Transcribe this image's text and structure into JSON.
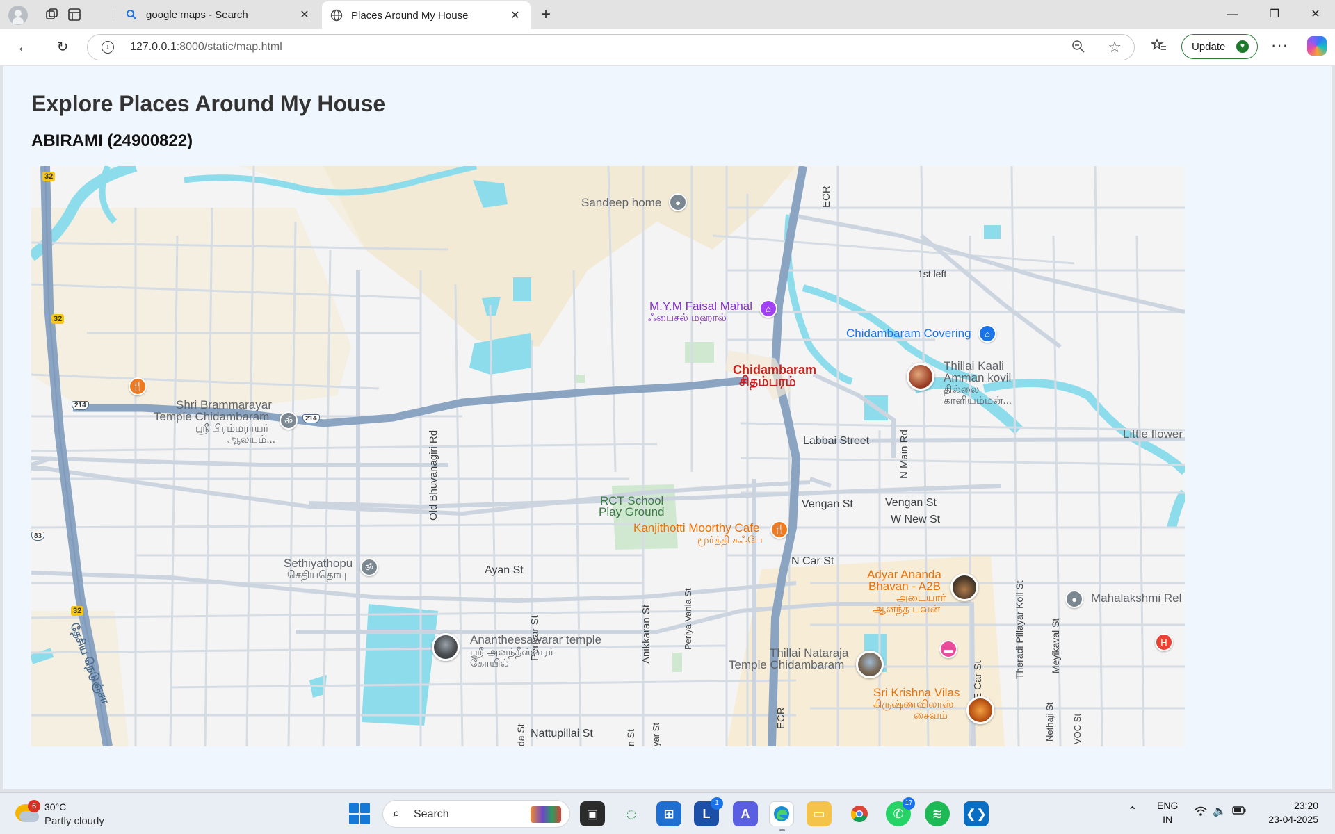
{
  "browser": {
    "tabs": [
      {
        "title": "google maps - Search",
        "icon": "search-icon",
        "active": false
      },
      {
        "title": "Places Around My House",
        "icon": "globe-icon",
        "active": true
      }
    ],
    "url_host": "127.0.0.1",
    "url_rest": ":8000/static/map.html",
    "update_label": "Update"
  },
  "page": {
    "title": "Explore Places Around My House",
    "subtitle": "ABIRAMI (24900822)"
  },
  "map": {
    "places": {
      "sandeep_home": "Sandeep home",
      "faisal_mahal": "M.Y.M Faisal Mahal",
      "faisal_mahal_ta": "ஃபைசல் மஹால்",
      "chidambaram_covering": "Chidambaram Covering",
      "chidambaram": "Chidambaram",
      "chidambaram_ta": "சிதம்பரம்",
      "thillai_kaali_1": "Thillai Kaali",
      "thillai_kaali_2": "Amman kovil",
      "thillai_kaali_ta1": "தில்லை",
      "thillai_kaali_ta2": "காளியம்மன்...",
      "brammarayar_1": "Shri Brammarayar",
      "brammarayar_2": "Temple Chidambaram",
      "brammarayar_ta1": "ஸ்ரீ பிரம்மராயர்",
      "brammarayar_ta2": "ஆலயம்...",
      "little_flower": "Little flower",
      "rct_1": "RCT School",
      "rct_2": "Play Ground",
      "kanjithotti": "Kanjithotti Moorthy Cafe",
      "kanjithotti_ta": "மூர்த்தி கஃபே",
      "sethiyathopu": "Sethiyathopu",
      "sethiyathopu_ta": "செதியதொபு",
      "adyar_1": "Adyar Ananda",
      "adyar_2": "Bhavan - A2B",
      "adyar_ta1": "அடையார்",
      "adyar_ta2": "ஆனந்த பவன்",
      "mahalakshmi": "Mahalakshmi Rel",
      "anantheesawarar": "Anantheesawarar temple",
      "anantheesawarar_ta1": "ஸ்ரீ அனந்தீஸ்வரர்",
      "anantheesawarar_ta2": "கோயில்",
      "nataraja_1": "Thillai Nataraja",
      "nataraja_2": "Temple Chidambaram",
      "krishna_vilas": "Sri Krishna Vilas",
      "krishna_vilas_ta1": "கிருஷ்ணவிலாஸ்",
      "krishna_vilas_ta2": "சைவம்"
    },
    "roads": {
      "ecr_top": "ECR",
      "ecr_bottom": "ECR",
      "first_left": "1st left",
      "labbai": "Labbai Street",
      "n_main": "N Main Rd",
      "vengan_1": "Vengan St",
      "vengan_2": "Vengan St",
      "w_new": "W New St",
      "n_car": "N Car St",
      "ayan": "Ayan St",
      "old_bhuvanagiri": "Old Bhuvanagiri Rd",
      "periyar": "Periyar St",
      "anikkaran": "Anikkaran St",
      "periya_vania": "Periya Vania St",
      "theradi": "Theradi Pillayar Koil St",
      "meyikaval": "Meyikaval St",
      "nethaji": "Nethaji St",
      "voc": "VOC St",
      "e_car": "E Car St",
      "nattupillai": "Nattupillai St",
      "nh_tamil": "தேசிய நெடுஞ்சா",
      "st_1": "da St",
      "st_2": "n St",
      "st_3": "yar St"
    },
    "shields": {
      "s32a": "32",
      "s32b": "32",
      "s32c": "32",
      "s214a": "214",
      "s214b": "214",
      "s83": "83"
    }
  },
  "taskbar": {
    "weather_badge": "6",
    "temperature": "30°C",
    "condition": "Partly cloudy",
    "search_label": "Search",
    "l_badge": "1",
    "whatsapp_badge": "17",
    "lang_1": "ENG",
    "lang_2": "IN",
    "time": "23:20",
    "date": "23-04-2025"
  }
}
